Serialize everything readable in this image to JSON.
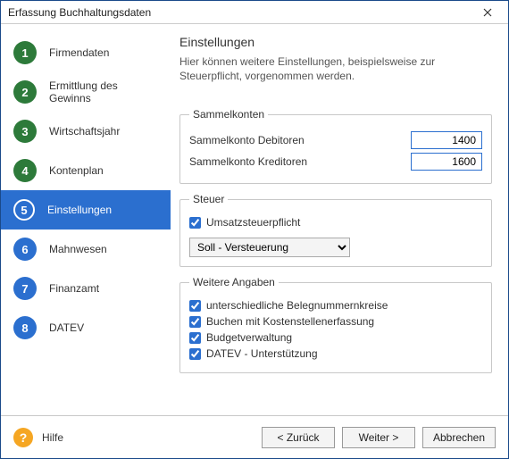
{
  "window": {
    "title": "Erfassung Buchhaltungsdaten"
  },
  "sidebar": {
    "steps": [
      {
        "num": "1",
        "label": "Firmendaten",
        "state": "done"
      },
      {
        "num": "2",
        "label": "Ermittlung des Gewinns",
        "state": "done"
      },
      {
        "num": "3",
        "label": "Wirtschaftsjahr",
        "state": "done"
      },
      {
        "num": "4",
        "label": "Kontenplan",
        "state": "done"
      },
      {
        "num": "5",
        "label": "Einstellungen",
        "state": "current"
      },
      {
        "num": "6",
        "label": "Mahnwesen",
        "state": "pending"
      },
      {
        "num": "7",
        "label": "Finanzamt",
        "state": "pending"
      },
      {
        "num": "8",
        "label": "DATEV",
        "state": "pending"
      }
    ]
  },
  "content": {
    "heading": "Einstellungen",
    "description": "Hier können weitere Einstellungen, beispielsweise zur Steuerpflicht, vorgenommen werden.",
    "sammelkonten": {
      "legend": "Sammelkonten",
      "debitoren_label": "Sammelkonto Debitoren",
      "debitoren_value": "1400",
      "kreditoren_label": "Sammelkonto Kreditoren",
      "kreditoren_value": "1600"
    },
    "steuer": {
      "legend": "Steuer",
      "umsatzsteuer_label": "Umsatzsteuerpflicht",
      "umsatzsteuer_checked": true,
      "versteuerung_option": "Soll - Versteuerung"
    },
    "weitere": {
      "legend": "Weitere Angaben",
      "opt1_label": "unterschiedliche Belegnummernkreise",
      "opt2_label": "Buchen mit Kostenstellenerfassung",
      "opt3_label": "Budgetverwaltung",
      "opt4_label": "DATEV - Unterstützung"
    }
  },
  "footer": {
    "help_label": "Hilfe",
    "back_label": "< Zurück",
    "next_label": "Weiter >",
    "cancel_label": "Abbrechen"
  }
}
